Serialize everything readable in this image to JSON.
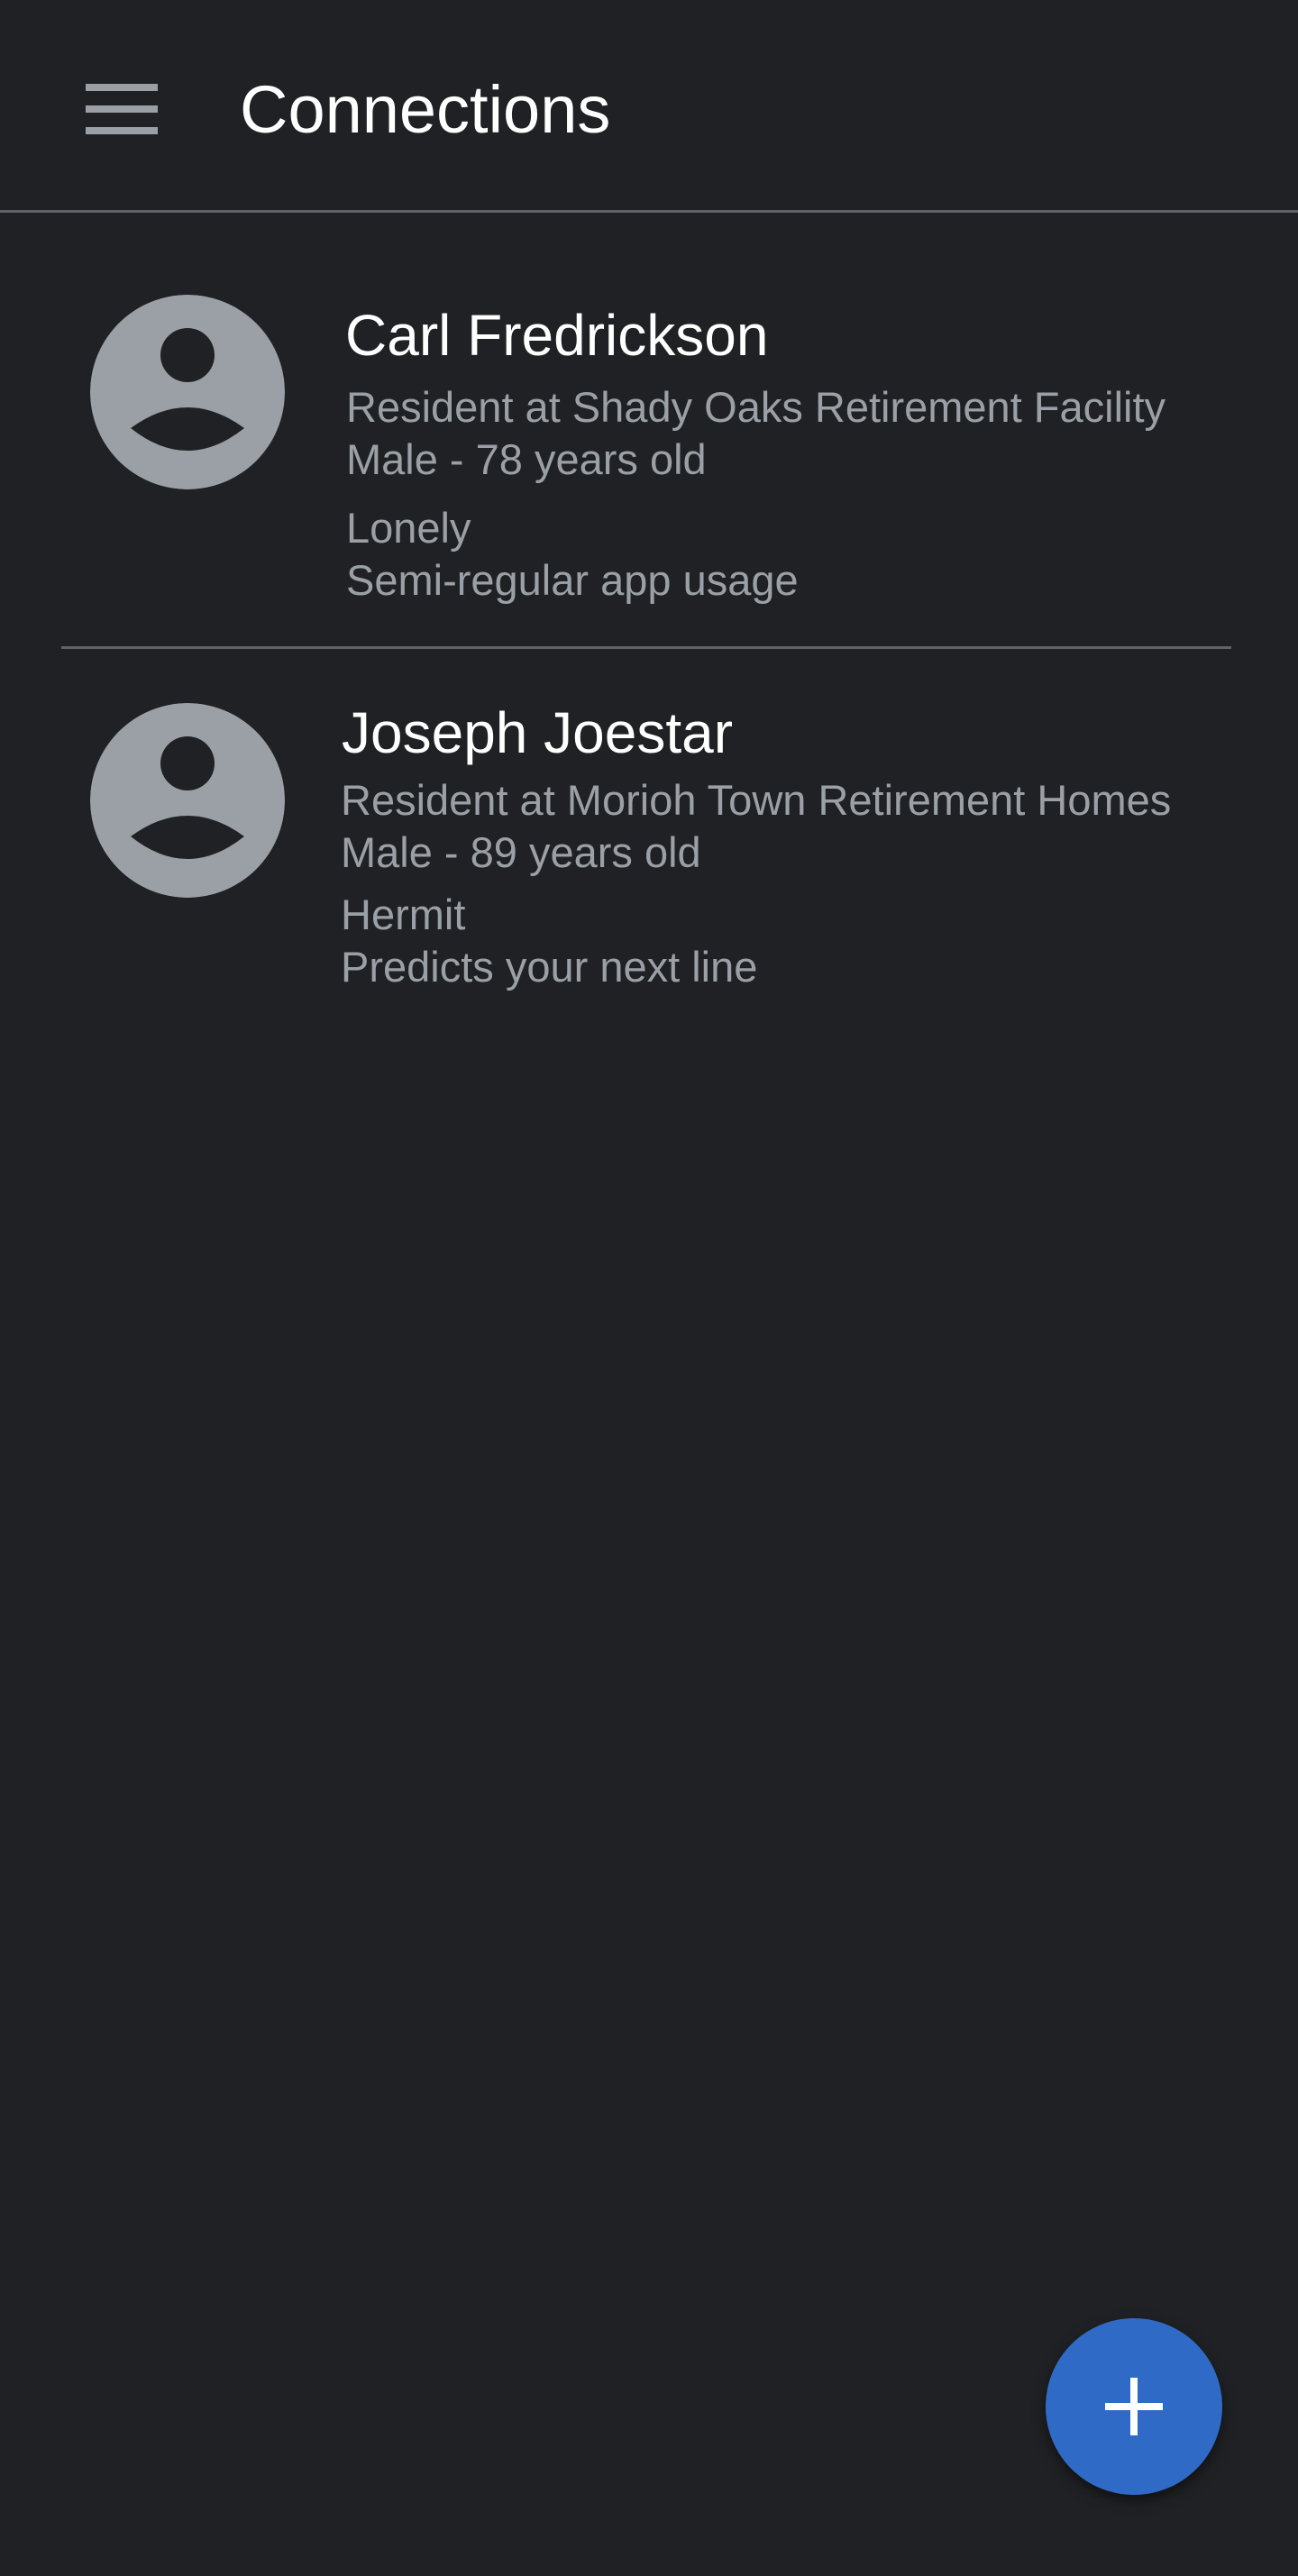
{
  "app_bar": {
    "menu_icon": "hamburger-menu-icon",
    "title": "Connections"
  },
  "connections": [
    {
      "name": "Carl Fredrickson",
      "residence": "Resident at Shady Oaks Retirement Facility",
      "demographics": "Male - 78 years old",
      "trait": "Lonely",
      "note": "Semi-regular app usage",
      "avatar_icon": "account-circle-icon"
    },
    {
      "name": "Joseph Joestar",
      "residence": "Resident at Morioh Town Retirement Homes",
      "demographics": "Male - 89 years old",
      "trait": "Hermit",
      "note": "Predicts your next line",
      "avatar_icon": "account-circle-icon"
    }
  ],
  "fab": {
    "icon": "plus-icon"
  },
  "colors": {
    "background": "#202124",
    "divider": "#5f6368",
    "secondary_text": "#9aa0a6",
    "avatar": "#9aa0a6",
    "fab": "#2f6ac6"
  }
}
